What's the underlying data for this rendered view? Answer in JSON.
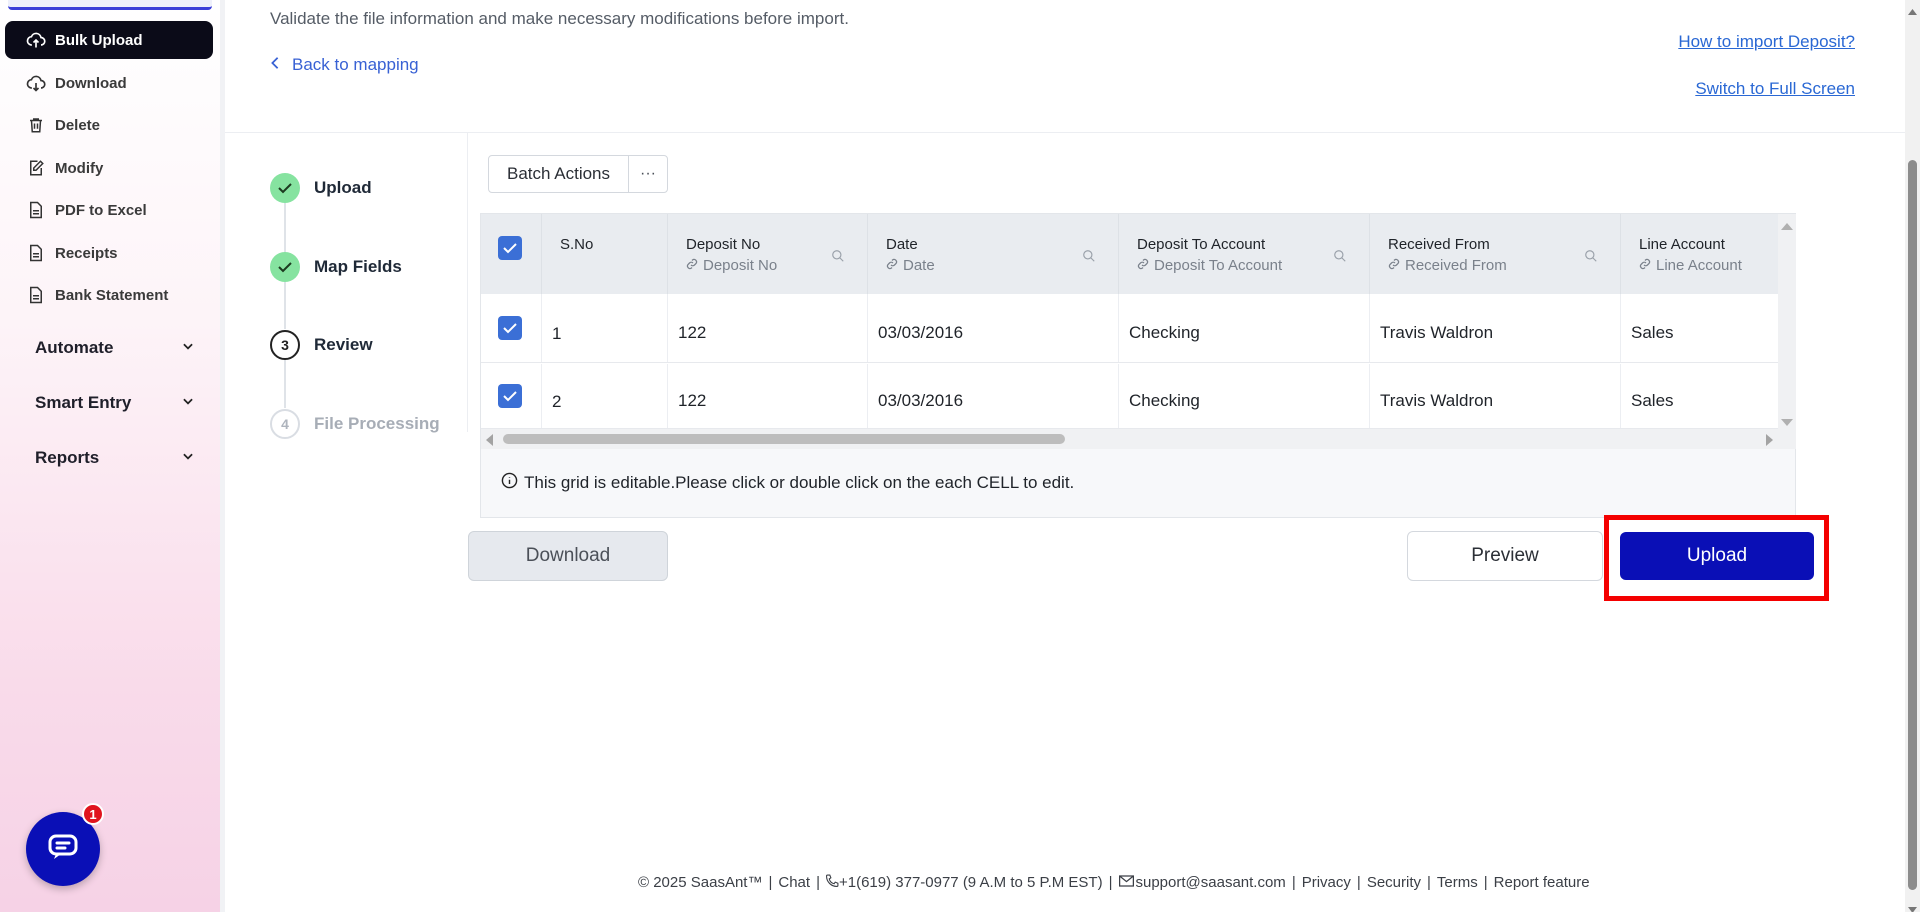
{
  "sidebar": {
    "items": [
      {
        "label": "Bulk Upload",
        "icon": "cloud-upload-icon",
        "active": true
      },
      {
        "label": "Download",
        "icon": "cloud-download-icon"
      },
      {
        "label": "Delete",
        "icon": "trash-icon"
      },
      {
        "label": "Modify",
        "icon": "edit-icon"
      },
      {
        "label": "PDF to Excel",
        "icon": "file-icon"
      },
      {
        "label": "Receipts",
        "icon": "file-icon"
      },
      {
        "label": "Bank Statement",
        "icon": "file-icon"
      }
    ],
    "groups": [
      {
        "label": "Automate"
      },
      {
        "label": "Smart Entry"
      },
      {
        "label": "Reports"
      }
    ],
    "chat_badge": "1"
  },
  "header": {
    "subtitle": "Validate the file information and make necessary modifications before import.",
    "back_label": "Back to mapping",
    "help_link": "How to import Deposit?",
    "fullscreen_link": "Switch to Full Screen"
  },
  "stepper": {
    "steps": [
      {
        "label": "Upload",
        "state": "done",
        "number": ""
      },
      {
        "label": "Map Fields",
        "state": "done",
        "number": ""
      },
      {
        "label": "Review",
        "state": "current",
        "number": "3"
      },
      {
        "label": "File Processing",
        "state": "todo",
        "number": "4"
      }
    ]
  },
  "toolbar": {
    "batch_label": "Batch Actions",
    "more_label": "···"
  },
  "grid": {
    "columns": [
      {
        "title": "S.No",
        "sub": ""
      },
      {
        "title": "Deposit No",
        "sub": "Deposit No"
      },
      {
        "title": "Date",
        "sub": "Date"
      },
      {
        "title": "Deposit To Account",
        "sub": "Deposit To Account"
      },
      {
        "title": "Received From",
        "sub": "Received From"
      },
      {
        "title": "Line Account",
        "sub": "Line Account"
      }
    ],
    "rows": [
      {
        "sno": "1",
        "deposit_no": "122",
        "date": "03/03/2016",
        "account": "Checking",
        "received_from": "Travis Waldron",
        "line_account": "Sales"
      },
      {
        "sno": "2",
        "deposit_no": "122",
        "date": "03/03/2016",
        "account": "Checking",
        "received_from": "Travis Waldron",
        "line_account": "Sales"
      }
    ],
    "note": "This grid is editable.Please click or double click on the each CELL to edit."
  },
  "actions": {
    "download_label": "Download",
    "preview_label": "Preview",
    "upload_label": "Upload"
  },
  "footer": {
    "copyright": "© 2025 SaasAnt™",
    "chat": "Chat",
    "phone": "+1(619) 377-0977 (9 A.M to 5 P.M EST)",
    "email": "support@saasant.com",
    "privacy": "Privacy",
    "security": "Security",
    "terms": "Terms",
    "report": "Report feature"
  },
  "colors": {
    "primary": "#0a0fb6",
    "link": "#2a68d4",
    "highlight": "#f40000",
    "step_done": "#86e3a0"
  }
}
